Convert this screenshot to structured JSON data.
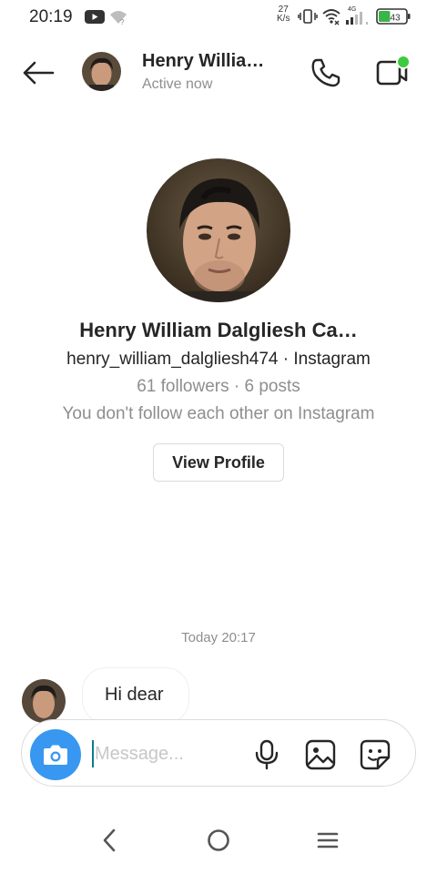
{
  "status_bar": {
    "time": "20:19",
    "net_speed_value": "27",
    "net_speed_unit": "K/s",
    "network_type": "4G",
    "battery_level": "43",
    "battery_color": "#3ab54a"
  },
  "header": {
    "name": "Henry Willia…",
    "status": "Active now",
    "online_dot_color": "#3ccb3c"
  },
  "profile": {
    "name": "Henry William Dalgliesh Ca…",
    "handle_line": "henry_william_dalgliesh474 · Instagram",
    "stats_line": "61 followers · 6 posts",
    "follow_line": "You don't follow each other on Instagram",
    "view_profile_label": "View Profile"
  },
  "chat": {
    "timestamp": "Today 20:17",
    "messages": [
      {
        "text": "Hi dear"
      }
    ]
  },
  "composer": {
    "placeholder": "Message...",
    "accent_color": "#3897f0"
  },
  "icons": {
    "back": "arrow-left-icon",
    "call": "phone-icon",
    "video": "video-camera-icon",
    "camera": "camera-icon",
    "mic": "microphone-icon",
    "gallery": "image-icon",
    "sticker": "sticker-icon"
  }
}
